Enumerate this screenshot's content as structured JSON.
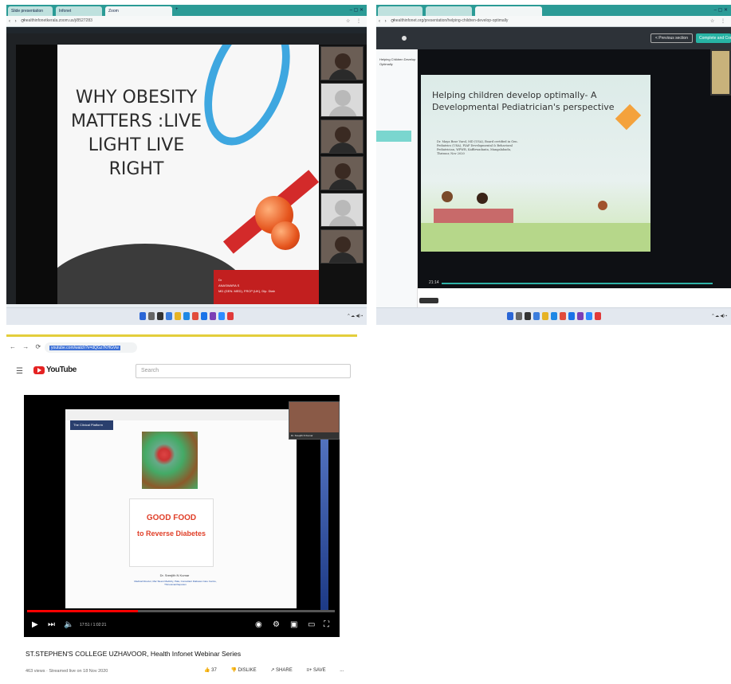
{
  "panel1": {
    "tabs": [
      "Slide presentation",
      "Infonet",
      "Zoom"
    ],
    "url": "healthinfonetkerala.zoom.us/j/8527283",
    "slide_title": "WHY OBESITY MATTERS :LIVE LIGHT LIVE RIGHT",
    "namecard": [
      "Dr",
      "ANASWARA S",
      "MD (GEN. MED), FRCP (UK), Dip. Diab"
    ]
  },
  "panel2": {
    "url": "healthinfonet.org/presentation/helping-children-develop-optimally",
    "sidebar_title": "Helping Children Develop Optimally",
    "prev_button": "< Previous section",
    "next_button": "Complete and Con",
    "slide_title": "Helping children develop optimally- A Developmental Pediatrician's perspective",
    "slide_subtitle": "Dr. Maya Bose Varol, MD (USA), Board certified in Gen. Pediatrics (USA), FIAP Developmental & Behavioral Pediatrician, WPWR, Kaffirwadanta, Mangalabadu, Thrissur, Nov 2020",
    "time": "21:14"
  },
  "panel3": {
    "url": "youtube.com/watch?v=dQGz7KHGVw",
    "logo": "YouTube",
    "search_placeholder": "Search",
    "badge": "The Clinical Platform",
    "food_line1": "GOOD FOOD",
    "food_line2": "to Reverse Diabetes",
    "presenter": "Dr. Sreejith N Kumar",
    "presenter_sub": "Medical Director, Mar Sleevi Medicity, Pala, Consultant Diabetes Care Centre, Thiruvananthapuram",
    "pip_caption": "Dr. Sreejith N Kumar",
    "time": "17:51 / 1:02:21",
    "video_title": "ST.STEPHEN'S COLLEGE UZHAVOOR, Health Infonet Webinar Series",
    "meta": "463 views · Streamed live on 18 Nov 2020",
    "likes": "37",
    "dislike": "DISLIKE",
    "share": "SHARE",
    "save": "SAVE",
    "more": "..."
  }
}
